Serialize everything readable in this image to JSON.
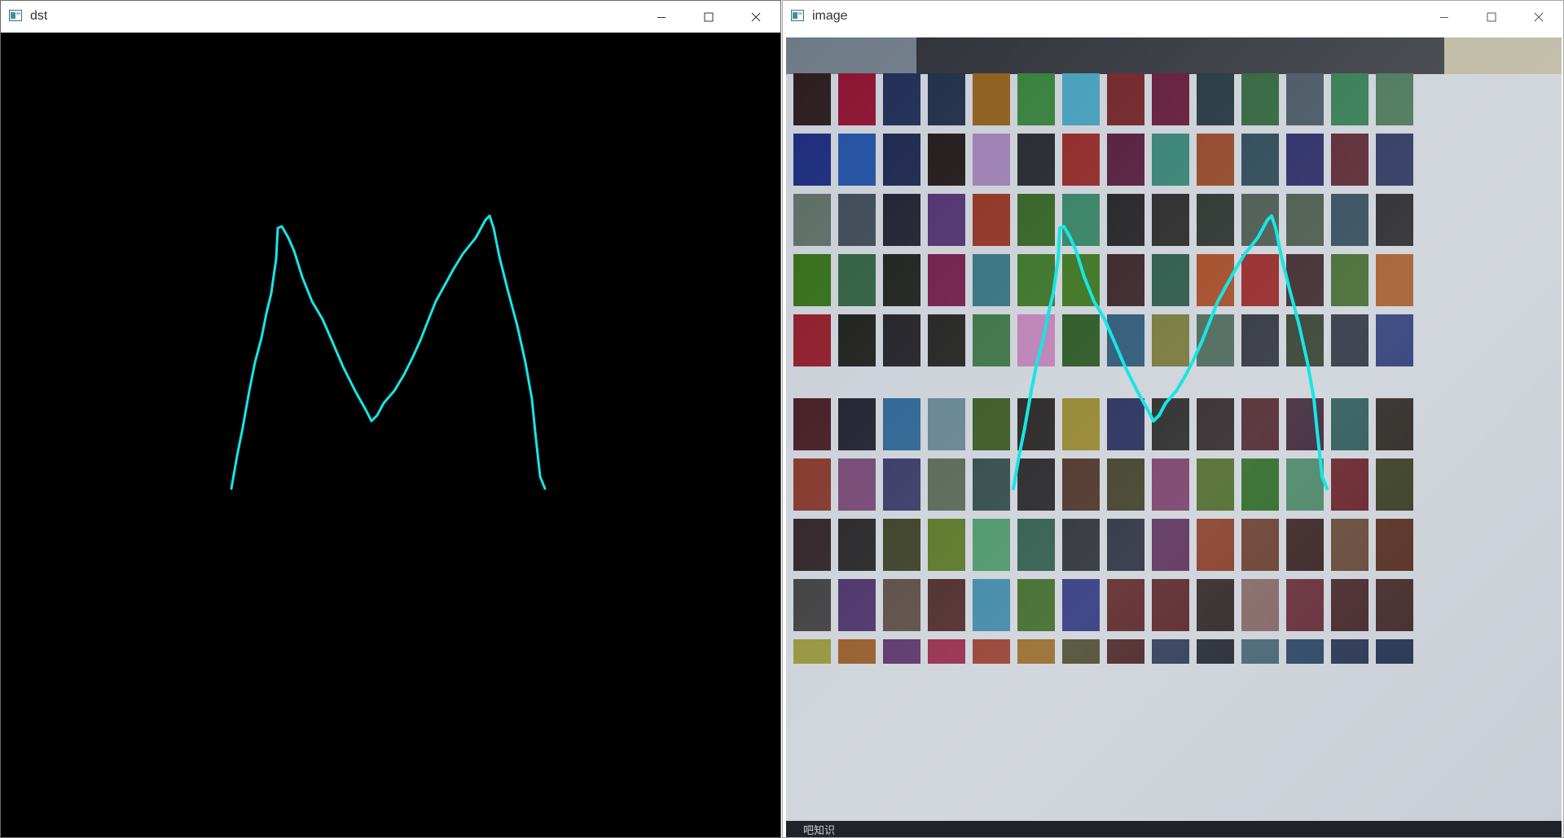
{
  "windows": {
    "dst": {
      "title": "dst"
    },
    "image": {
      "title": "image"
    }
  },
  "icons": {
    "app": "app-window-icon",
    "minimize": "minimize-icon",
    "maximize": "maximize-icon",
    "close": "close-icon"
  },
  "colors": {
    "stroke": "#16e6e6",
    "dst_background": "#000000",
    "chart_background": "#c9ced6"
  },
  "image_footer_text": "吧知识"
}
